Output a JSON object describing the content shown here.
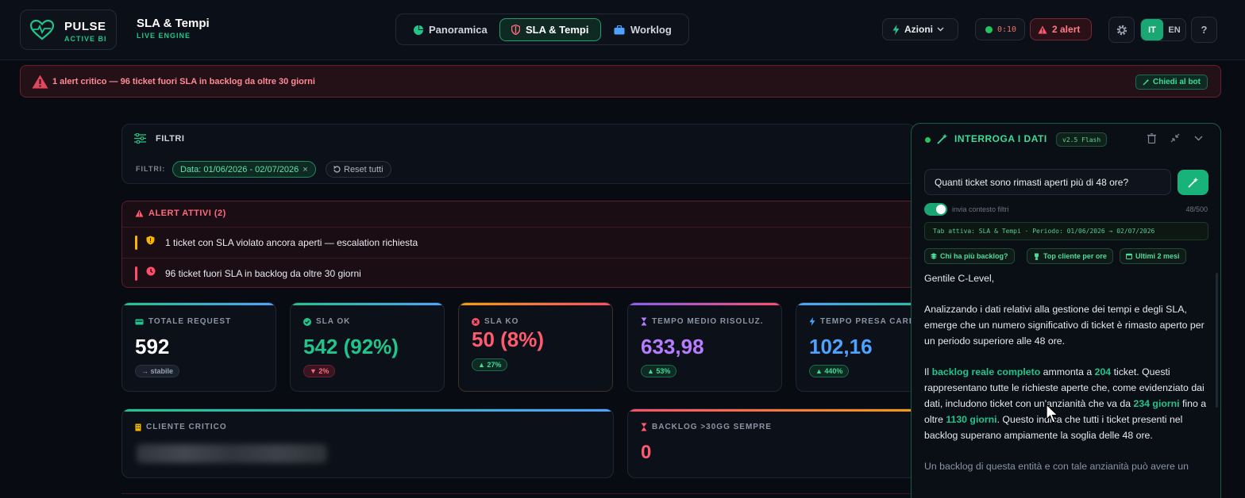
{
  "brand": {
    "name": "PULSE",
    "tagline": "ACTIVE BI"
  },
  "page": {
    "title": "SLA & Tempi",
    "subtitle": "LIVE ENGINE"
  },
  "tabs": [
    {
      "label": "Panoramica",
      "icon": "pie-chart-icon"
    },
    {
      "label": "SLA & Tempi",
      "icon": "shield-icon",
      "active": true
    },
    {
      "label": "Worklog",
      "icon": "briefcase-icon"
    }
  ],
  "header": {
    "actions_label": "Azioni",
    "timer": "0:10",
    "alerts_label": "2 alert",
    "lang_it": "IT",
    "lang_en": "EN",
    "help": "?"
  },
  "banner": {
    "text": "1 alert critico — 96 ticket fuori SLA in backlog da oltre 30 giorni",
    "ask_bot": "Chiedi al bot"
  },
  "filters": {
    "title": "FILTRI",
    "label": "FILTRI:",
    "date_chip": "Data: 01/06/2026 - 02/07/2026",
    "chip_close": "×",
    "reset": "Reset tutti"
  },
  "alerts": {
    "title": "ALERT ATTIVI (2)",
    "items": [
      {
        "text": "1 ticket con SLA violato ancora aperti — escalation richiesta",
        "color": "#f5b700"
      },
      {
        "text": "96 ticket fuori SLA in backlog da oltre 30 giorni",
        "color": "#ff4d6a"
      }
    ]
  },
  "kpis": [
    {
      "label": "TOTALE REQUEST",
      "value": "592",
      "badge": "→ stabile",
      "color": "#ffffff"
    },
    {
      "label": "SLA OK",
      "value": "542 (92%)",
      "badge": "▼ 2%",
      "color": "#21c48a"
    },
    {
      "label": "SLA KO",
      "value": "50 (8%)",
      "badge": "▲ 27%",
      "color": "#ff5a6e"
    },
    {
      "label": "TEMPO MEDIO RISOLUZ.",
      "value": "633,98",
      "badge": "▲ 53%",
      "color": "#b77cff"
    },
    {
      "label": "TEMPO PRESA CARICO",
      "value": "102,16",
      "badge": "▲ 440%",
      "color": "#4da3ff"
    }
  ],
  "cards": {
    "critical_client_label": "CLIENTE CRITICO",
    "backlog_label": "BACKLOG >30GG SEMPRE",
    "backlog_value": "0"
  },
  "chat": {
    "title": "INTERROGA I DATI",
    "version": "v2.5 Flash",
    "question": "Quanti ticket sono rimasti aperti più di 48 ore?",
    "toggle_label": "invia contesto filtri",
    "char_count": "48/500",
    "context": "Tab attiva: SLA & Tempi · Periodo: 01/06/2026 → 02/07/2026",
    "suggestions": [
      "Chi ha più backlog?",
      "Top cliente per ore",
      "Ultimi 2 mesi"
    ],
    "answer": {
      "greeting": "Gentile C-Level,",
      "p1": "Analizzando i dati relativi alla gestione dei tempi e degli SLA, emerge che un numero significativo di ticket è rimasto aperto per un periodo superiore alle 48 ore.",
      "p2_a": "Il ",
      "p2_hl1": "backlog reale completo",
      "p2_b": " ammonta a ",
      "p2_hl2": "204",
      "p2_c": " ticket. Questi rappresentano tutte le richieste aperte che, come evidenziato dai dati, includono ticket con un'anzianità che va da ",
      "p2_hl3": "234 giorni",
      "p2_d": " fino a oltre ",
      "p2_hl4": "1130 giorni",
      "p2_e": ". Questo indica che tutti i ticket presenti nel backlog superano ampiamente la soglia delle 48 ore.",
      "p3": "Un backlog di questa entità e con tale anzianità può avere un"
    }
  }
}
